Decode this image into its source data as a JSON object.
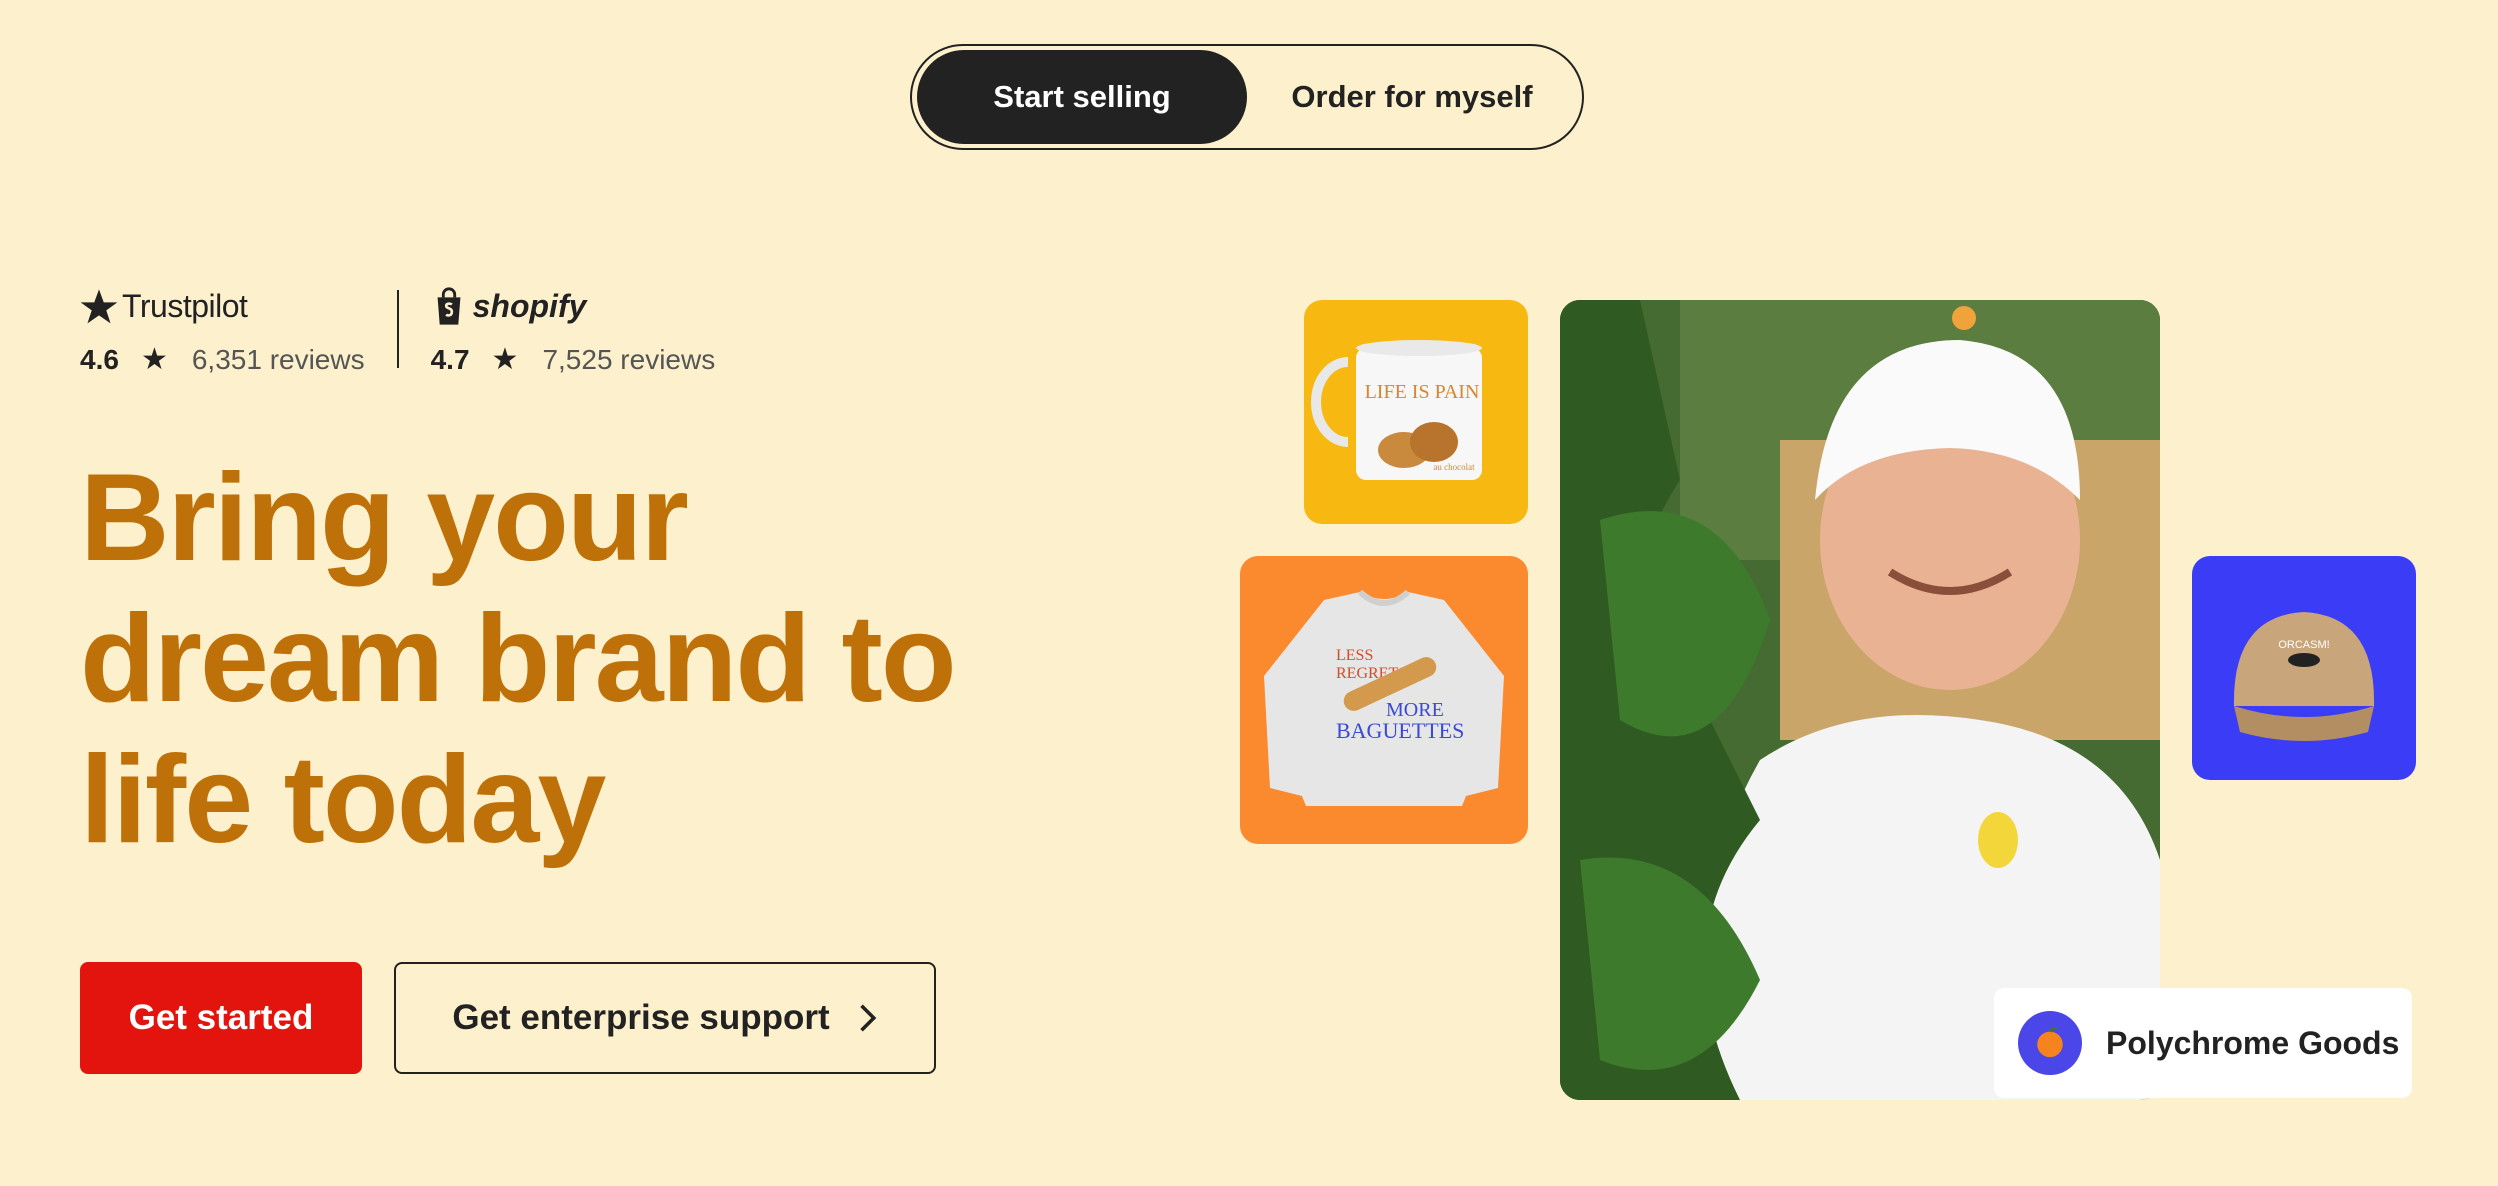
{
  "toggle": {
    "active_label": "Start selling",
    "inactive_label": "Order for myself"
  },
  "ratings": {
    "trustpilot": {
      "brand": "Trustpilot",
      "score": "4.6",
      "reviews": "6,351 reviews"
    },
    "shopify": {
      "brand": "shopify",
      "score": "4.7",
      "reviews": "7,525 reviews"
    }
  },
  "hero": {
    "headline": "Bring your dream brand to life today"
  },
  "cta": {
    "primary_label": "Get started",
    "secondary_label": "Get enterprise support"
  },
  "products": {
    "mug_text_top": "LIFE IS PAIN",
    "mug_text_bottom": "au chocolat",
    "sweatshirt_line1": "LESS",
    "sweatshirt_line2": "REGRETS",
    "sweatshirt_line3": "MORE",
    "sweatshirt_line4": "BAGUETTES",
    "cap_text": "ORCASM!"
  },
  "store": {
    "name": "Polychrome Goods"
  },
  "colors": {
    "background": "#fdf0cc",
    "headline": "#bf7109",
    "primary_button": "#e3140e",
    "mug_tile": "#f7b811",
    "sweatshirt_tile": "#fb8a2e",
    "cap_tile": "#3b3cf6"
  }
}
